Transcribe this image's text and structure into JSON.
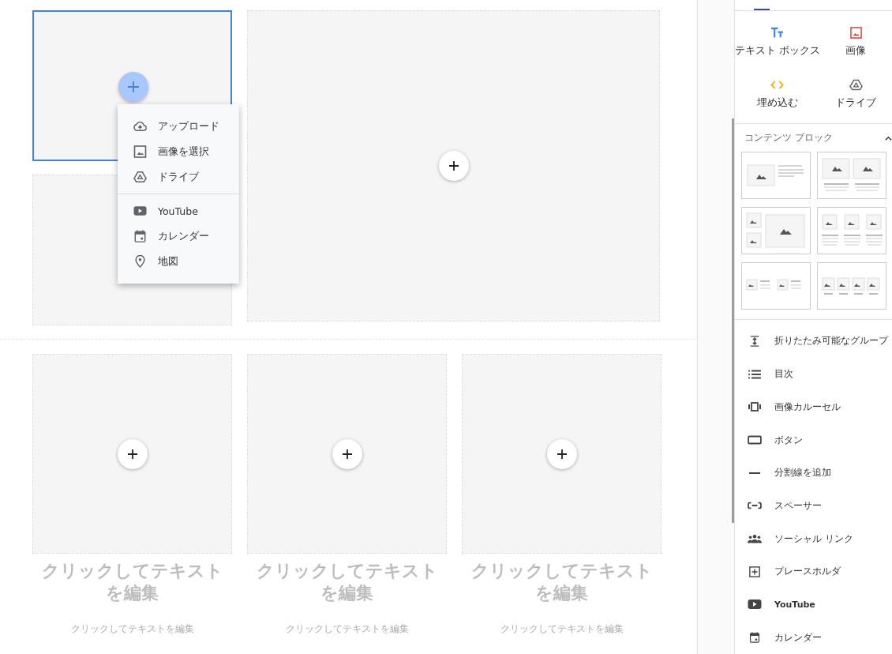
{
  "canvas": {
    "upper_tiles": [
      {
        "selected": true
      },
      {
        "selected": false
      },
      {
        "selected": false
      }
    ],
    "add_menu": {
      "groups": [
        [
          {
            "label": "アップロード"
          },
          {
            "label": "画像を選択"
          },
          {
            "label": "ドライブ"
          }
        ],
        [
          {
            "label": "YouTube"
          },
          {
            "label": "カレンダー"
          },
          {
            "label": "地図"
          }
        ]
      ]
    },
    "cards": [
      {
        "heading": "クリックしてテキストを編集",
        "body": "クリックしてテキストを編集"
      },
      {
        "heading": "クリックしてテキストを編集",
        "body": "クリックしてテキストを編集"
      },
      {
        "heading": "クリックしてテキストを編集",
        "body": "クリックしてテキストを編集"
      }
    ]
  },
  "sidebar": {
    "insert_items": [
      {
        "label": "テキスト ボックス"
      },
      {
        "label": "画像"
      },
      {
        "label": "埋め込む"
      },
      {
        "label": "ドライブ"
      }
    ],
    "content_blocks": {
      "title": "コンテンツ ブロック",
      "expanded": true
    },
    "components": [
      {
        "label": "折りたたみ可能なグループ"
      },
      {
        "label": "目次"
      },
      {
        "label": "画像カルーセル"
      },
      {
        "label": "ボタン"
      },
      {
        "label": "分割線を追加"
      },
      {
        "label": "スペーサー"
      },
      {
        "label": "ソーシャル リンク"
      },
      {
        "label": "プレースホルダ"
      },
      {
        "label": "YouTube"
      },
      {
        "label": "カレンダー"
      }
    ]
  }
}
